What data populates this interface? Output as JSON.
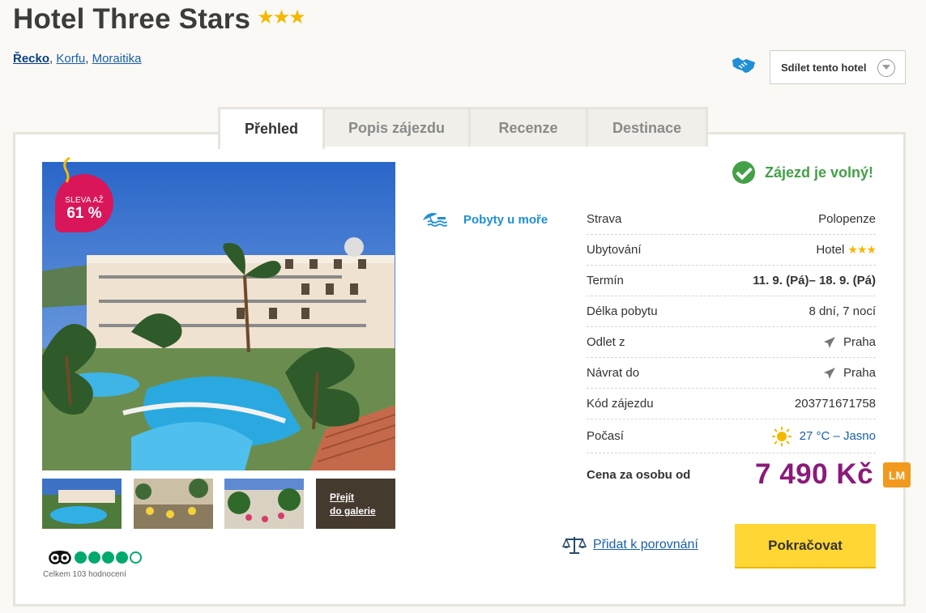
{
  "hotel": {
    "name": "Hotel Three Stars",
    "stars": "★★★"
  },
  "breadcrumb": {
    "country": "Řecko",
    "sep1": ", ",
    "island": "Korfu",
    "sep2": ", ",
    "town": "Moraitika"
  },
  "share": {
    "label": "Sdílet tento hotel"
  },
  "tabs": [
    {
      "label": "Přehled",
      "active": true
    },
    {
      "label": "Popis zájezdu",
      "active": false
    },
    {
      "label": "Recenze",
      "active": false
    },
    {
      "label": "Destinace",
      "active": false
    }
  ],
  "sale": {
    "line1": "SLEVA AŽ",
    "line2": "61 %"
  },
  "gallery": {
    "link_line1": "Přejít",
    "link_line2": "do galerie"
  },
  "rating": {
    "filled": 4,
    "total": 5,
    "text": "Celkem 103 hodnocení"
  },
  "category": {
    "label": "Pobyty u moře"
  },
  "availability": {
    "label": "Zájezd je volný!"
  },
  "details": [
    {
      "label": "Strava",
      "value": "Polopenze"
    },
    {
      "label": "Ubytování",
      "value": "Hotel",
      "stars": "★★★"
    },
    {
      "label": "Termín",
      "value": "11. 9. (Pá)– 18. 9. (Pá)"
    },
    {
      "label": "Délka pobytu",
      "value": "8 dní, 7 nocí"
    },
    {
      "label": "Odlet z",
      "value": "Praha"
    },
    {
      "label": "Návrat do",
      "value": "Praha"
    },
    {
      "label": "Kód zájezdu",
      "value": "203771671758"
    },
    {
      "label": "Počasí",
      "value": "27 °C – Jasno"
    }
  ],
  "price": {
    "label": "Cena za osobu od",
    "value": "7 490 Kč",
    "badge": "LM"
  },
  "actions": {
    "compare": "Přidat k porovnání",
    "continue": "Pokračovat"
  },
  "colors": {
    "accent_purple": "#8b1a7a",
    "sale_pink": "#d9165a",
    "button_yellow": "#ffd633",
    "green": "#43a047",
    "link_blue": "#1a5fa8",
    "lm_orange": "#f29a1e"
  }
}
